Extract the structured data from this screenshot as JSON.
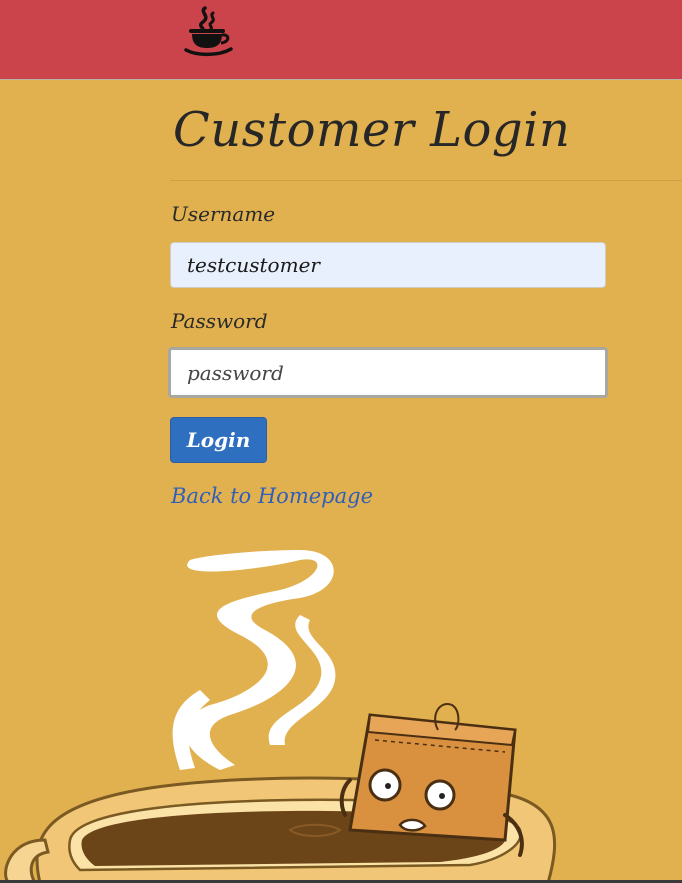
{
  "header": {
    "logo_icon": "coffee-cup-icon",
    "background_color": "#cc444b"
  },
  "page": {
    "title": "Customer Login",
    "background_color": "#e2b14f"
  },
  "form": {
    "username_label": "Username",
    "username_value": "testcustomer",
    "password_label": "Password",
    "password_value": "password",
    "login_label": "Login",
    "back_link_label": "Back to Homepage",
    "button_color": "#2f6fbf",
    "link_color": "#2f5fb8"
  },
  "illustration": {
    "icon": "tea-bag-in-coffee-cup-icon"
  }
}
